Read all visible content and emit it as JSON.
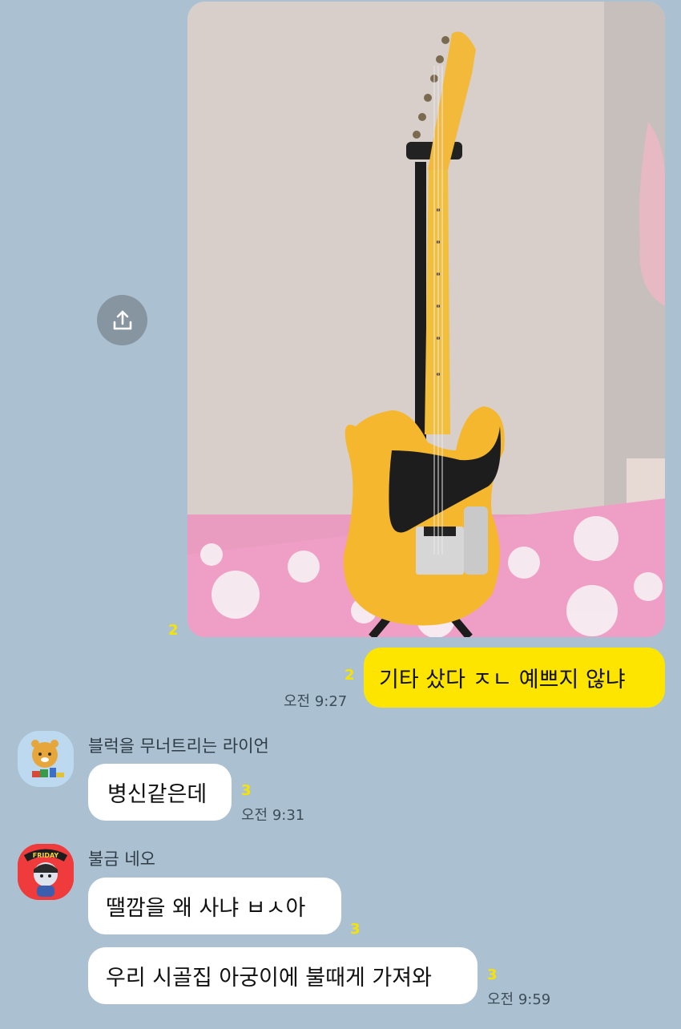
{
  "messages": {
    "photo": {
      "unread": "2"
    },
    "text": {
      "text": "기타 샀다 ㅈㄴ 예쁘지 않냐",
      "unread": "2",
      "time": "오전 9:27"
    }
  },
  "lion": {
    "name": "블럭을 무너트리는 라이언",
    "message": "병신같은데",
    "unread": "3",
    "time": "오전 9:31"
  },
  "neo": {
    "name": "불금 네오",
    "badge": "FRIDAY",
    "message1": "땔깜을 왜 사냐 ㅂㅅ아",
    "unread1": "3",
    "message2": "우리 시골집 아궁이에 불때게 가져와",
    "unread2": "3",
    "time": "오전 9:59"
  },
  "colors": {
    "background": "#abc1d1",
    "my_bubble": "#fee500",
    "unread": "#f7e300"
  }
}
